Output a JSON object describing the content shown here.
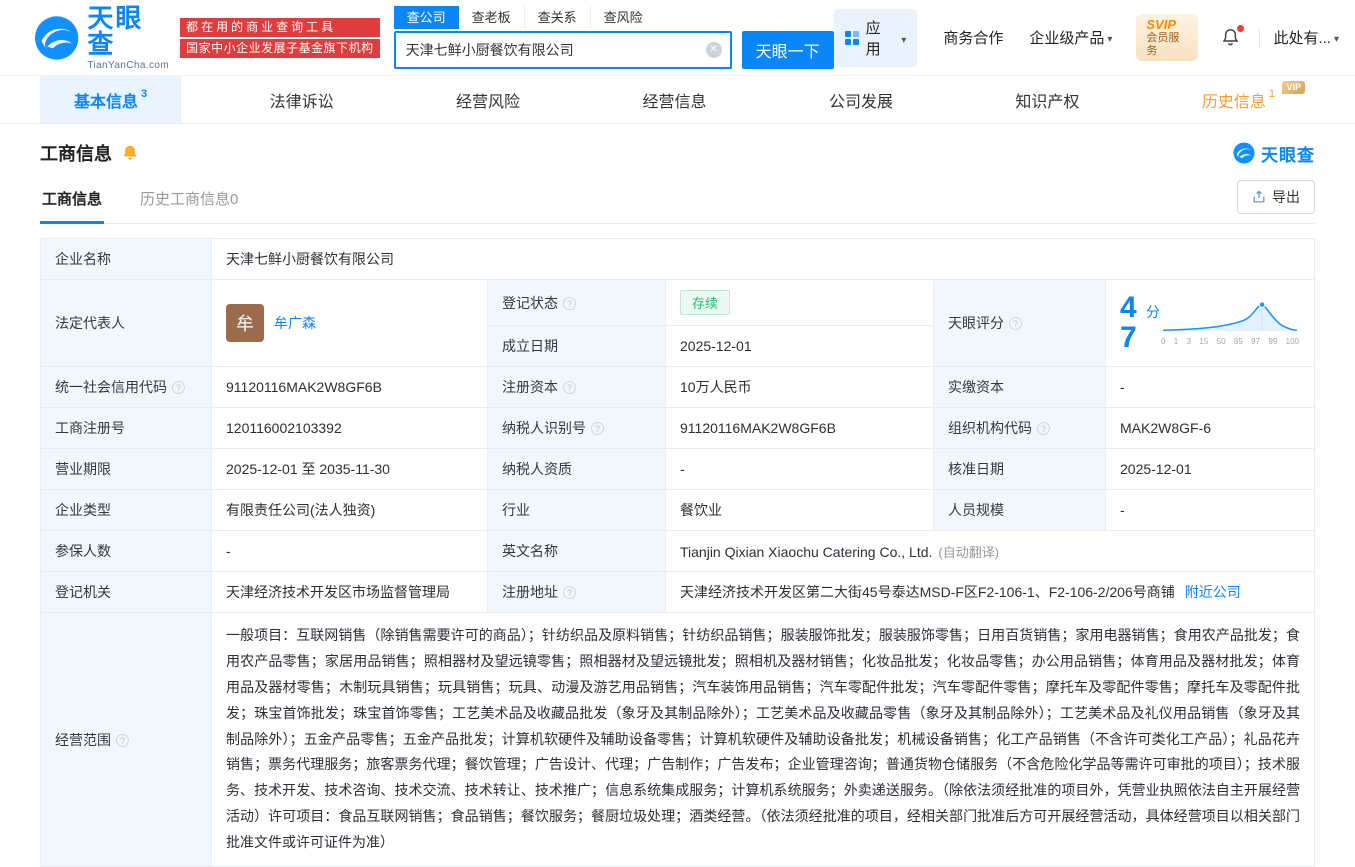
{
  "colors": {
    "accent": "#0b86f8",
    "brand_red": "#df3d3d",
    "status_green": "#2bb673",
    "history_orange": "#ff9a2e",
    "vip_gold": "#d5a356"
  },
  "header": {
    "brand": "天眼查",
    "brand_domain": "TianYanCha.com",
    "slogan_line1": "都在用的商业查询工具",
    "slogan_line2": "国家中小企业发展子基金旗下机构",
    "search": {
      "tabs": [
        {
          "label": "查公司"
        },
        {
          "label": "查老板"
        },
        {
          "label": "查关系"
        },
        {
          "label": "查风险"
        }
      ],
      "value": "天津七鲜小厨餐饮有限公司",
      "button": "天眼一下"
    },
    "menu": {
      "apps": "应用",
      "cooperation": "商务合作",
      "enterprise": "企业级产品",
      "svip_title": "SVIP",
      "svip_subtitle": "会员服务",
      "user": "此处有..."
    }
  },
  "nav": {
    "tabs": [
      {
        "label": "基本信息",
        "sup": "3"
      },
      {
        "label": "法律诉讼"
      },
      {
        "label": "经营风险"
      },
      {
        "label": "经营信息"
      },
      {
        "label": "公司发展"
      },
      {
        "label": "知识产权"
      },
      {
        "label": "历史信息",
        "sup": "1",
        "tag": "VIP"
      }
    ]
  },
  "section": {
    "title": "工商信息",
    "logo_text": "天眼查",
    "subtabs": {
      "current": "工商信息",
      "history": "历史工商信息0"
    },
    "export_label": "导出"
  },
  "table": {
    "company_name_label": "企业名称",
    "company_name": "天津七鲜小厨餐饮有限公司",
    "legal_rep_label": "法定代表人",
    "legal_rep_avatar": "牟",
    "legal_rep_name": "牟广森",
    "reg_status_label": "登记状态",
    "reg_status": "存续",
    "establish_date_label": "成立日期",
    "establish_date": "2025-12-01",
    "score_label": "天眼评分",
    "score_value": "47",
    "score_unit": "分",
    "score_axis": [
      "0",
      "1",
      "3",
      "15",
      "50",
      "85",
      "97",
      "99",
      "100"
    ],
    "credit_code_label": "统一社会信用代码",
    "credit_code": "91120116MAK2W8GF6B",
    "reg_capital_label": "注册资本",
    "reg_capital": "10万人民币",
    "paid_capital_label": "实缴资本",
    "paid_capital": "-",
    "reg_number_label": "工商注册号",
    "reg_number": "120116002103392",
    "taxpayer_id_label": "纳税人识别号",
    "taxpayer_id": "91120116MAK2W8GF6B",
    "org_code_label": "组织机构代码",
    "org_code": "MAK2W8GF-6",
    "term_label": "营业期限",
    "term": "2025-12-01 至 2035-11-30",
    "taxpayer_quality_label": "纳税人资质",
    "taxpayer_quality": "-",
    "approval_date_label": "核准日期",
    "approval_date": "2025-12-01",
    "company_type_label": "企业类型",
    "company_type": "有限责任公司(法人独资)",
    "industry_label": "行业",
    "industry": "餐饮业",
    "staff_label": "人员规模",
    "staff": "-",
    "insured_label": "参保人数",
    "insured": "-",
    "english_name_label": "英文名称",
    "english_name": "Tianjin Qixian Xiaochu Catering Co., Ltd.",
    "english_name_note": "(自动翻译)",
    "authority_label": "登记机关",
    "authority": "天津经济技术开发区市场监督管理局",
    "address_label": "注册地址",
    "address": "天津经济技术开发区第二大街45号泰达MSD-F区F2-106-1、F2-106-2/206号商铺",
    "nearby_link": "附近公司",
    "scope_label": "经营范围",
    "scope": "一般项目：互联网销售（除销售需要许可的商品）；针纺织品及原料销售；针纺织品销售；服装服饰批发；服装服饰零售；日用百货销售；家用电器销售；食用农产品批发；食用农产品零售；家居用品销售；照相器材及望远镜零售；照相器材及望远镜批发；照相机及器材销售；化妆品批发；化妆品零售；办公用品销售；体育用品及器材批发；体育用品及器材零售；木制玩具销售；玩具销售；玩具、动漫及游艺用品销售；汽车装饰用品销售；汽车零配件批发；汽车零配件零售；摩托车及零配件零售；摩托车及零配件批发；珠宝首饰批发；珠宝首饰零售；工艺美术品及收藏品批发（象牙及其制品除外）；工艺美术品及收藏品零售（象牙及其制品除外）；工艺美术品及礼仪用品销售（象牙及其制品除外）；五金产品零售；五金产品批发；计算机软硬件及辅助设备零售；计算机软硬件及辅助设备批发；机械设备销售；化工产品销售（不含许可类化工产品）；礼品花卉销售；票务代理服务；旅客票务代理；餐饮管理；广告设计、代理；广告制作；广告发布；企业管理咨询；普通货物仓储服务（不含危险化学品等需许可审批的项目）；技术服务、技术开发、技术咨询、技术交流、技术转让、技术推广；信息系统集成服务；计算机系统服务；外卖递送服务。（除依法须经批准的项目外，凭营业执照依法自主开展经营活动）许可项目：食品互联网销售；食品销售；餐饮服务；餐厨垃圾处理；酒类经营。（依法须经批准的项目，经相关部门批准后方可开展经营活动，具体经营项目以相关部门批准文件或许可证件为准）"
  }
}
